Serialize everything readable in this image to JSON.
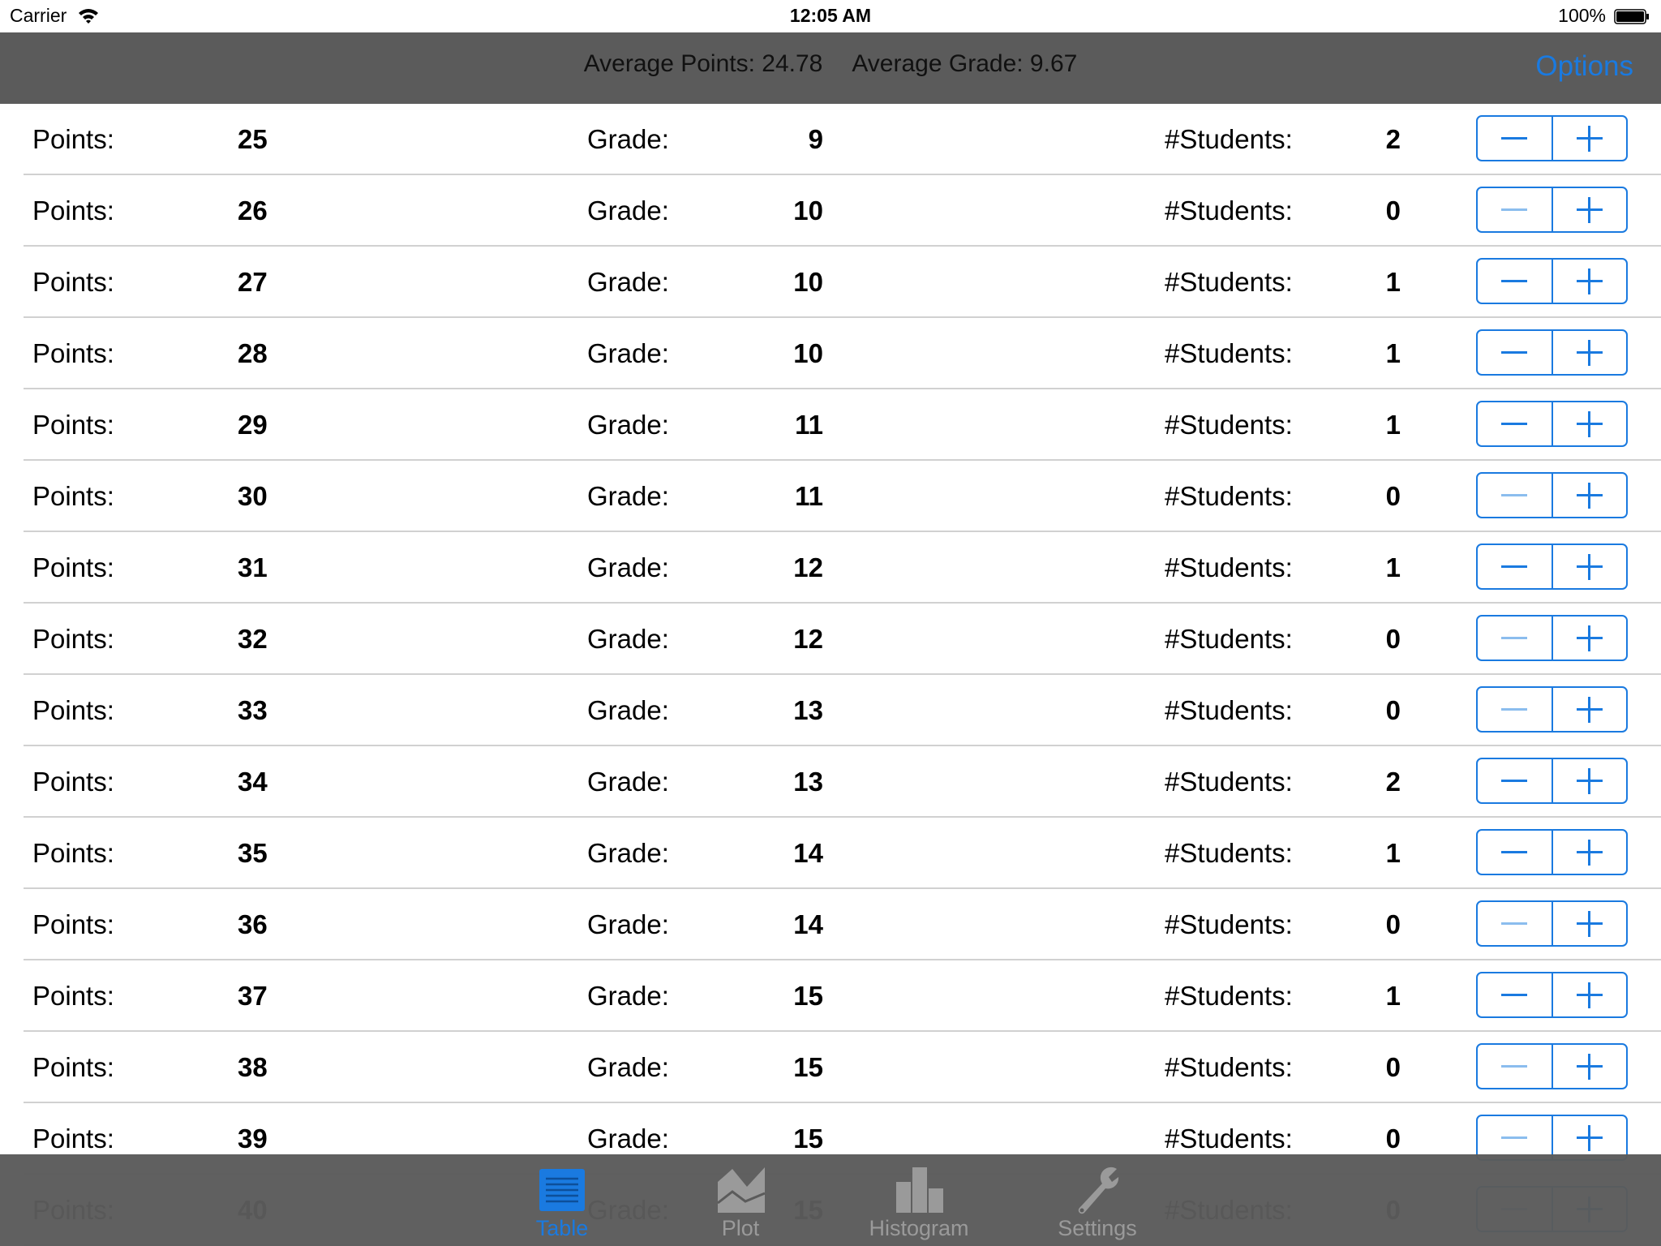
{
  "status_bar": {
    "carrier": "Carrier",
    "time": "12:05 AM",
    "battery": "100%"
  },
  "nav_bar": {
    "average_points": "Average Points: 24.78",
    "average_grade": "Average Grade: 9.67",
    "options_label": "Options"
  },
  "labels": {
    "points": "Points:",
    "grade": "Grade:",
    "students": "#Students:"
  },
  "rows": [
    {
      "points": "25",
      "grade": "9",
      "students": "2",
      "minus_enabled": true
    },
    {
      "points": "26",
      "grade": "10",
      "students": "0",
      "minus_enabled": false
    },
    {
      "points": "27",
      "grade": "10",
      "students": "1",
      "minus_enabled": true
    },
    {
      "points": "28",
      "grade": "10",
      "students": "1",
      "minus_enabled": true
    },
    {
      "points": "29",
      "grade": "11",
      "students": "1",
      "minus_enabled": true
    },
    {
      "points": "30",
      "grade": "11",
      "students": "0",
      "minus_enabled": false
    },
    {
      "points": "31",
      "grade": "12",
      "students": "1",
      "minus_enabled": true
    },
    {
      "points": "32",
      "grade": "12",
      "students": "0",
      "minus_enabled": false
    },
    {
      "points": "33",
      "grade": "13",
      "students": "0",
      "minus_enabled": false
    },
    {
      "points": "34",
      "grade": "13",
      "students": "2",
      "minus_enabled": true
    },
    {
      "points": "35",
      "grade": "14",
      "students": "1",
      "minus_enabled": true
    },
    {
      "points": "36",
      "grade": "14",
      "students": "0",
      "minus_enabled": false
    },
    {
      "points": "37",
      "grade": "15",
      "students": "1",
      "minus_enabled": true
    },
    {
      "points": "38",
      "grade": "15",
      "students": "0",
      "minus_enabled": false
    },
    {
      "points": "39",
      "grade": "15",
      "students": "0",
      "minus_enabled": false
    },
    {
      "points": "40",
      "grade": "15",
      "students": "0",
      "minus_enabled": false
    }
  ],
  "tab_bar": {
    "tabs": [
      {
        "label": "Table",
        "icon": "table-icon",
        "active": true
      },
      {
        "label": "Plot",
        "icon": "plot-icon",
        "active": false
      },
      {
        "label": "Histogram",
        "icon": "histogram-icon",
        "active": false
      },
      {
        "label": "Settings",
        "icon": "wrench-icon",
        "active": false
      }
    ]
  },
  "colors": {
    "accent": "#1a7ae0",
    "bar_background": "#5b5b5b",
    "tab_inactive": "#9a9a9a"
  }
}
